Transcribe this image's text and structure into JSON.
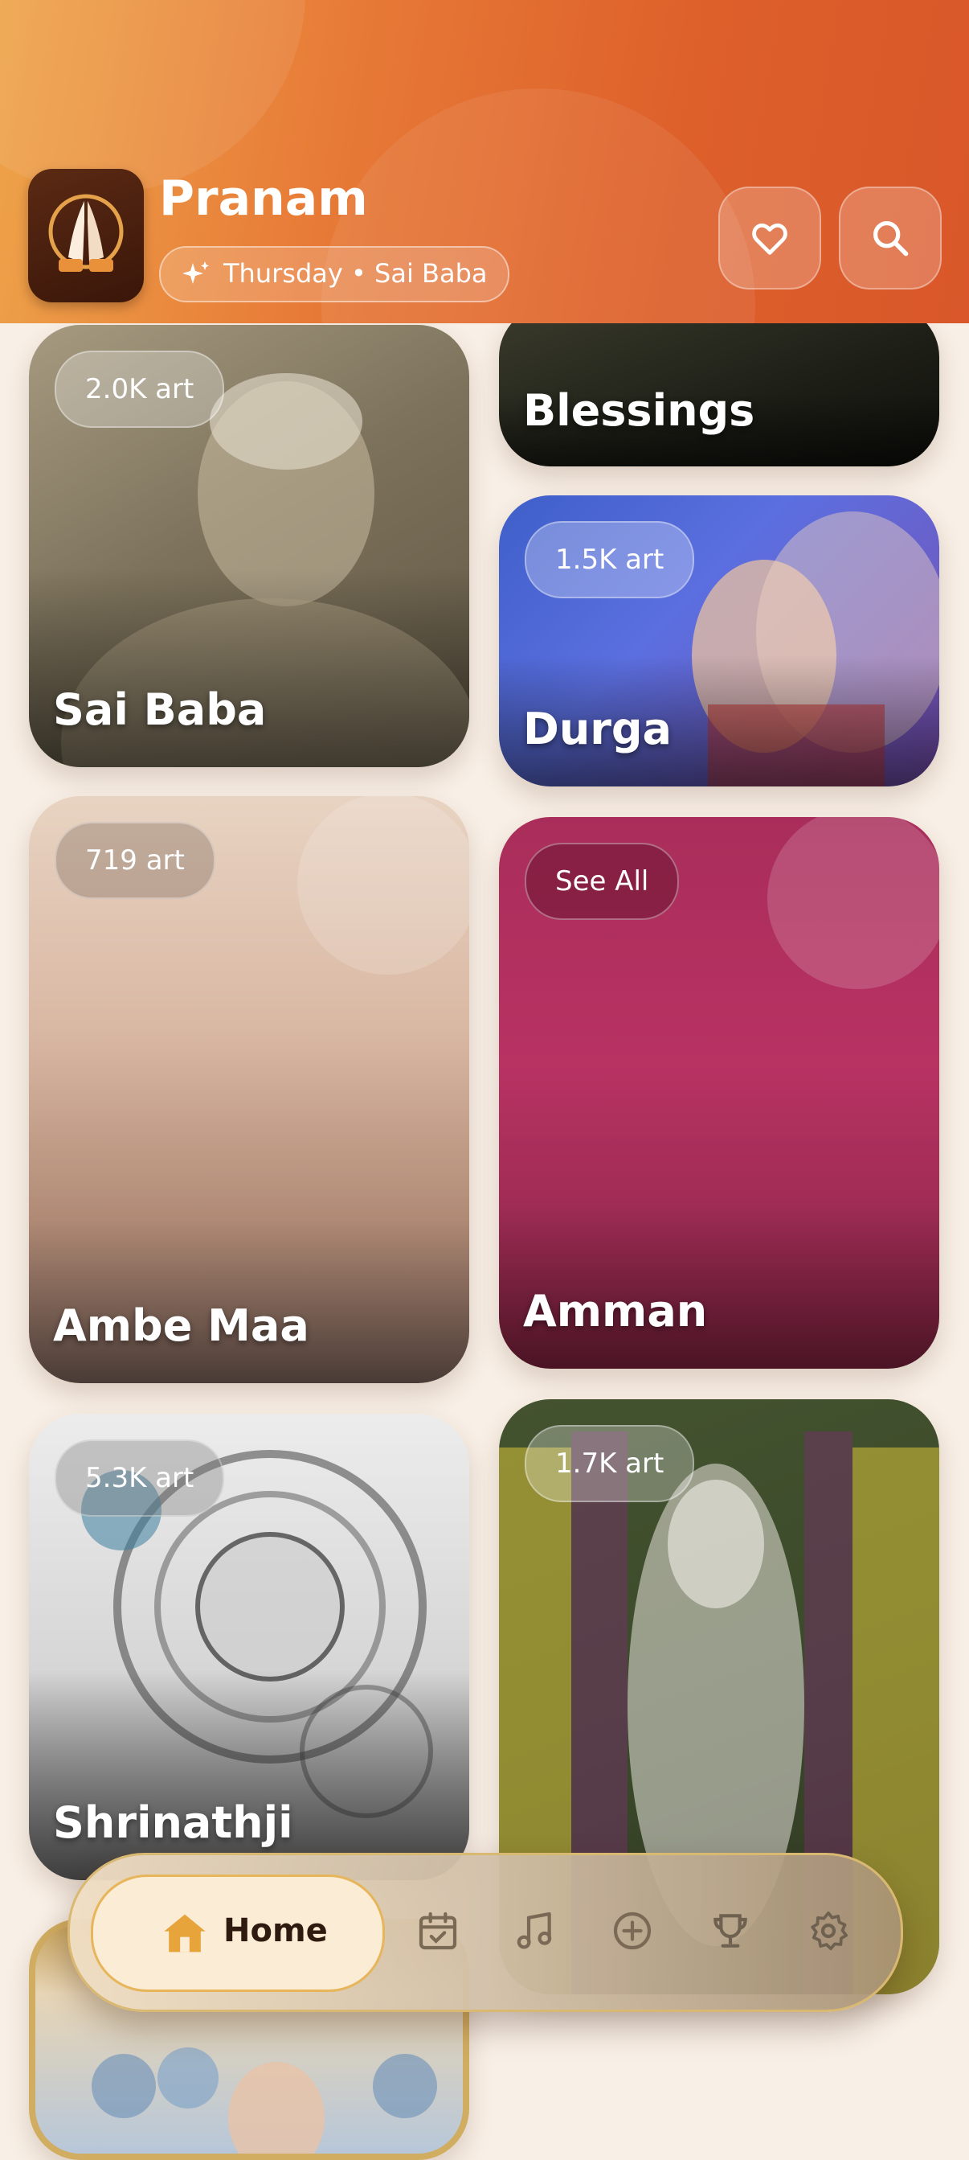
{
  "header": {
    "app_title": "Pranam",
    "day_label": "Thursday • Sai Baba",
    "favorites_icon": "heart-icon",
    "search_icon": "search-icon"
  },
  "cards": {
    "blessings": {
      "name": "Blessings"
    },
    "sai_baba": {
      "name": "Sai Baba",
      "badge": "2.0K art"
    },
    "durga": {
      "name": "Durga",
      "badge": "1.5K art"
    },
    "ambe_maa": {
      "name": "Ambe Maa",
      "badge": "719 art"
    },
    "amman": {
      "name": "Amman",
      "badge": "See All"
    },
    "shrinathji": {
      "name": "Shrinathji",
      "badge": "5.3K art"
    },
    "murugan": {
      "badge": "1.7K art"
    }
  },
  "nav": {
    "home_label": "Home",
    "items": [
      "home-icon",
      "calendar-icon",
      "music-icon",
      "add-icon",
      "trophy-icon",
      "settings-icon"
    ]
  },
  "colors": {
    "header_orange": "#dd5f2a",
    "accent_gold": "#e7b55a",
    "amman_pink": "#b83262"
  }
}
